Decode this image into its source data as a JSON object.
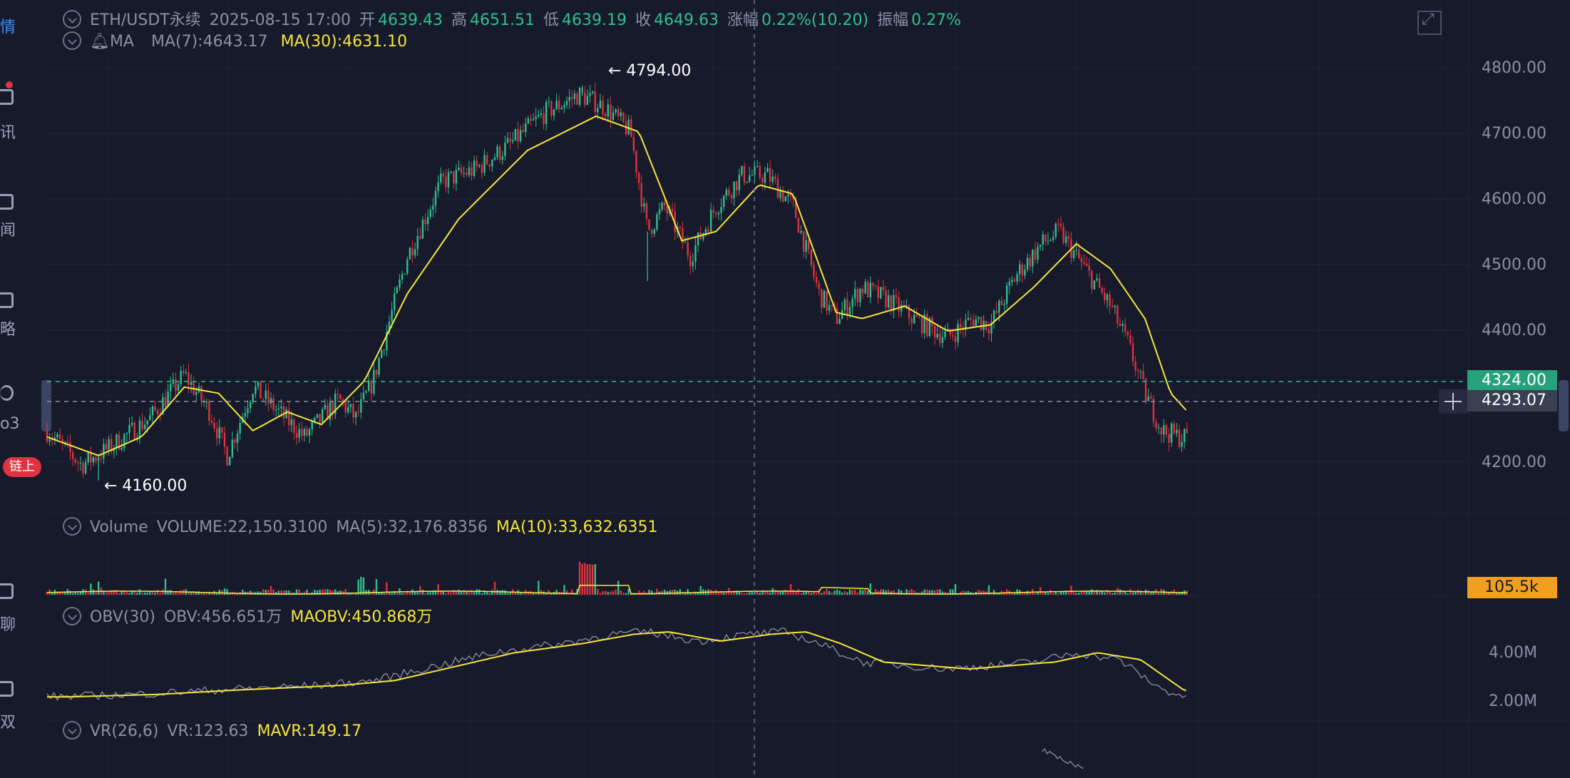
{
  "sidebar": {
    "labels": [
      "情",
      "讯",
      "闻",
      "略",
      "o3",
      "链上",
      "聊",
      "双"
    ]
  },
  "header": {
    "pair": "ETH/USDT永续",
    "datetime": "2025-08-15 17:00",
    "open_label": "开",
    "open": "4639.43",
    "high_label": "高",
    "high": "4651.51",
    "low_label": "低",
    "low": "4639.19",
    "close_label": "收",
    "close": "4649.63",
    "change_label": "涨幅",
    "change": "0.22%(10.20)",
    "amp_label": "振幅",
    "amp": "0.27%"
  },
  "ma": {
    "name": "MA",
    "ma7": "MA(7):4643.17",
    "ma30": "MA(30):4631.10"
  },
  "annotations": {
    "high_mark": "← 4794.00",
    "low_mark": "← 4160.00"
  },
  "price_axis": [
    "4800.00",
    "4700.00",
    "4600.00",
    "4500.00",
    "4400.00",
    "4200.00"
  ],
  "tags": {
    "last_price": "4324.00",
    "crosshair_price": "4293.07",
    "volume": "105.5k"
  },
  "volume": {
    "name": "Volume",
    "value": "VOLUME:22,150.3100",
    "ma5": "MA(5):32,176.8356",
    "ma10": "MA(10):33,632.6351"
  },
  "obv": {
    "name": "OBV(30)",
    "value": "OBV:456.651万",
    "maobv": "MAOBV:450.868万",
    "axis": [
      "4.00M",
      "2.00M"
    ]
  },
  "vr": {
    "name": "VR(26,6)",
    "value": "VR:123.63",
    "mavr": "MAVR:149.17"
  },
  "colors": {
    "up": "#2fbf8f",
    "down": "#e0323f",
    "ma_line": "#f5e53b",
    "obv_line": "#8b90a3",
    "background": "#161a2b"
  },
  "chart_data": {
    "type": "line",
    "ylim": [
      4130,
      4840
    ],
    "price_trend": [
      [
        0,
        4240
      ],
      [
        40,
        4185
      ],
      [
        70,
        4210
      ],
      [
        120,
        4260
      ],
      [
        160,
        4330
      ],
      [
        190,
        4270
      ],
      [
        210,
        4200
      ],
      [
        240,
        4310
      ],
      [
        270,
        4270
      ],
      [
        300,
        4230
      ],
      [
        340,
        4290
      ],
      [
        360,
        4260
      ],
      [
        380,
        4320
      ],
      [
        420,
        4520
      ],
      [
        460,
        4640
      ],
      [
        500,
        4660
      ],
      [
        540,
        4700
      ],
      [
        580,
        4750
      ],
      [
        620,
        4780
      ],
      [
        650,
        4760
      ],
      [
        680,
        4720
      ],
      [
        700,
        4560
      ],
      [
        720,
        4600
      ],
      [
        750,
        4520
      ],
      [
        780,
        4600
      ],
      [
        810,
        4650
      ],
      [
        840,
        4650
      ],
      [
        870,
        4600
      ],
      [
        900,
        4460
      ],
      [
        920,
        4420
      ],
      [
        950,
        4470
      ],
      [
        980,
        4450
      ],
      [
        1010,
        4420
      ],
      [
        1050,
        4390
      ],
      [
        1080,
        4420
      ],
      [
        1100,
        4410
      ],
      [
        1130,
        4490
      ],
      [
        1160,
        4540
      ],
      [
        1180,
        4560
      ],
      [
        1200,
        4520
      ],
      [
        1220,
        4480
      ],
      [
        1240,
        4440
      ],
      [
        1260,
        4380
      ],
      [
        1280,
        4300
      ],
      [
        1300,
        4240
      ],
      [
        1320,
        4230
      ]
    ],
    "ma30_trend": [
      [
        0,
        4230
      ],
      [
        60,
        4200
      ],
      [
        110,
        4230
      ],
      [
        160,
        4310
      ],
      [
        200,
        4300
      ],
      [
        240,
        4240
      ],
      [
        280,
        4270
      ],
      [
        320,
        4250
      ],
      [
        370,
        4320
      ],
      [
        420,
        4460
      ],
      [
        480,
        4580
      ],
      [
        560,
        4690
      ],
      [
        640,
        4745
      ],
      [
        690,
        4720
      ],
      [
        740,
        4545
      ],
      [
        780,
        4560
      ],
      [
        830,
        4635
      ],
      [
        870,
        4620
      ],
      [
        920,
        4430
      ],
      [
        950,
        4420
      ],
      [
        1000,
        4440
      ],
      [
        1050,
        4400
      ],
      [
        1100,
        4410
      ],
      [
        1150,
        4470
      ],
      [
        1200,
        4540
      ],
      [
        1240,
        4500
      ],
      [
        1280,
        4420
      ],
      [
        1310,
        4300
      ],
      [
        1330,
        4270
      ]
    ],
    "obv_trend": [
      [
        0,
        1.9
      ],
      [
        100,
        2.0
      ],
      [
        200,
        2.2
      ],
      [
        320,
        2.4
      ],
      [
        380,
        2.6
      ],
      [
        450,
        3.2
      ],
      [
        520,
        3.8
      ],
      [
        600,
        4.2
      ],
      [
        660,
        4.6
      ],
      [
        700,
        4.7
      ],
      [
        760,
        4.3
      ],
      [
        820,
        4.6
      ],
      [
        860,
        4.7
      ],
      [
        900,
        4.2
      ],
      [
        950,
        3.4
      ],
      [
        1050,
        3.1
      ],
      [
        1150,
        3.4
      ],
      [
        1200,
        3.8
      ],
      [
        1250,
        3.5
      ],
      [
        1300,
        2.2
      ],
      [
        1330,
        1.9
      ]
    ],
    "obv_ylim": [
      1.2,
      5.5
    ]
  }
}
